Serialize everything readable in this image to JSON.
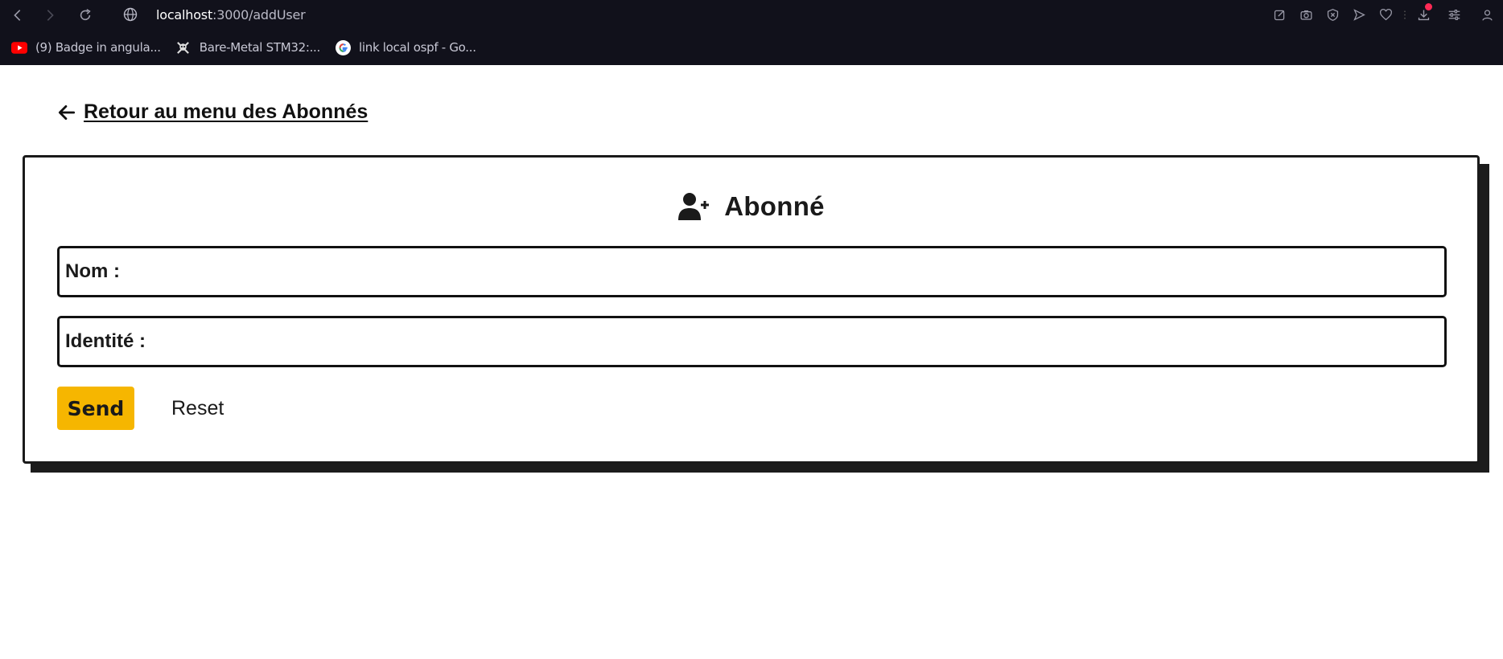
{
  "browser": {
    "url_host": "localhost",
    "url_path": ":3000/addUser",
    "bookmarks": [
      {
        "label": "(9) Badge in angula...",
        "icon": "youtube-icon"
      },
      {
        "label": "Bare-Metal STM32:...",
        "icon": "skull-icon"
      },
      {
        "label": "link local ospf - Go...",
        "icon": "google-icon"
      }
    ],
    "colors": {
      "chrome_bg": "#11111b",
      "notification_dot": "#ff2a55"
    }
  },
  "page": {
    "back_link": "Retour au menu des Abonnés",
    "card_title": "Abonné",
    "fields": {
      "nom": {
        "label": "Nom :",
        "value": ""
      },
      "identite": {
        "label": "Identité :",
        "value": ""
      }
    },
    "buttons": {
      "send": "Send",
      "reset": "Reset"
    },
    "colors": {
      "accent": "#f6b600",
      "border": "#1a1a1a"
    }
  }
}
